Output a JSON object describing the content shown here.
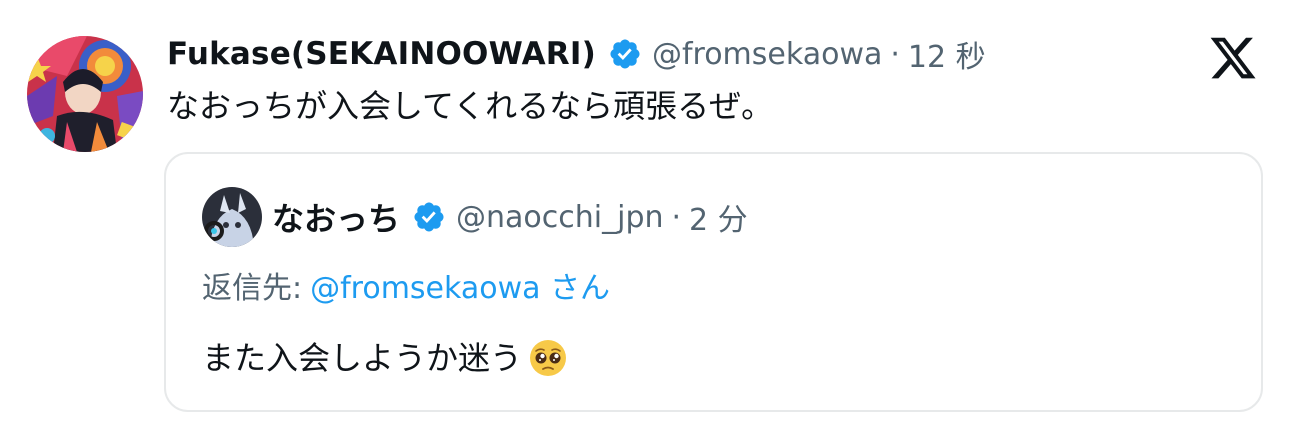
{
  "tweet": {
    "author": {
      "display_name": "Fukase(SEKAINOOWARI)",
      "handle": "@fromsekaowa",
      "time": "12 秒",
      "avatar": "avatar-illustration",
      "verified": true
    },
    "separator": "·",
    "text": "なおっちが入会してくれるなら頑張るぜ。",
    "platform_icon": "x-logo-icon"
  },
  "quote": {
    "author": {
      "display_name": "なおっち",
      "handle": "@naocchi_jpn",
      "time": "2 分",
      "avatar": "avatar-character",
      "verified": true
    },
    "separator": "·",
    "reply": {
      "prefix": "返信先:",
      "mention": "@fromsekaowa さん"
    },
    "text": "また入会しようか迷う",
    "emoji": "pleading-face-icon"
  },
  "colors": {
    "verified": "#1d9bf0",
    "link": "#1d9bf0",
    "secondary_text": "#536471",
    "border": "#e7e9ea",
    "text": "#0f1419"
  }
}
